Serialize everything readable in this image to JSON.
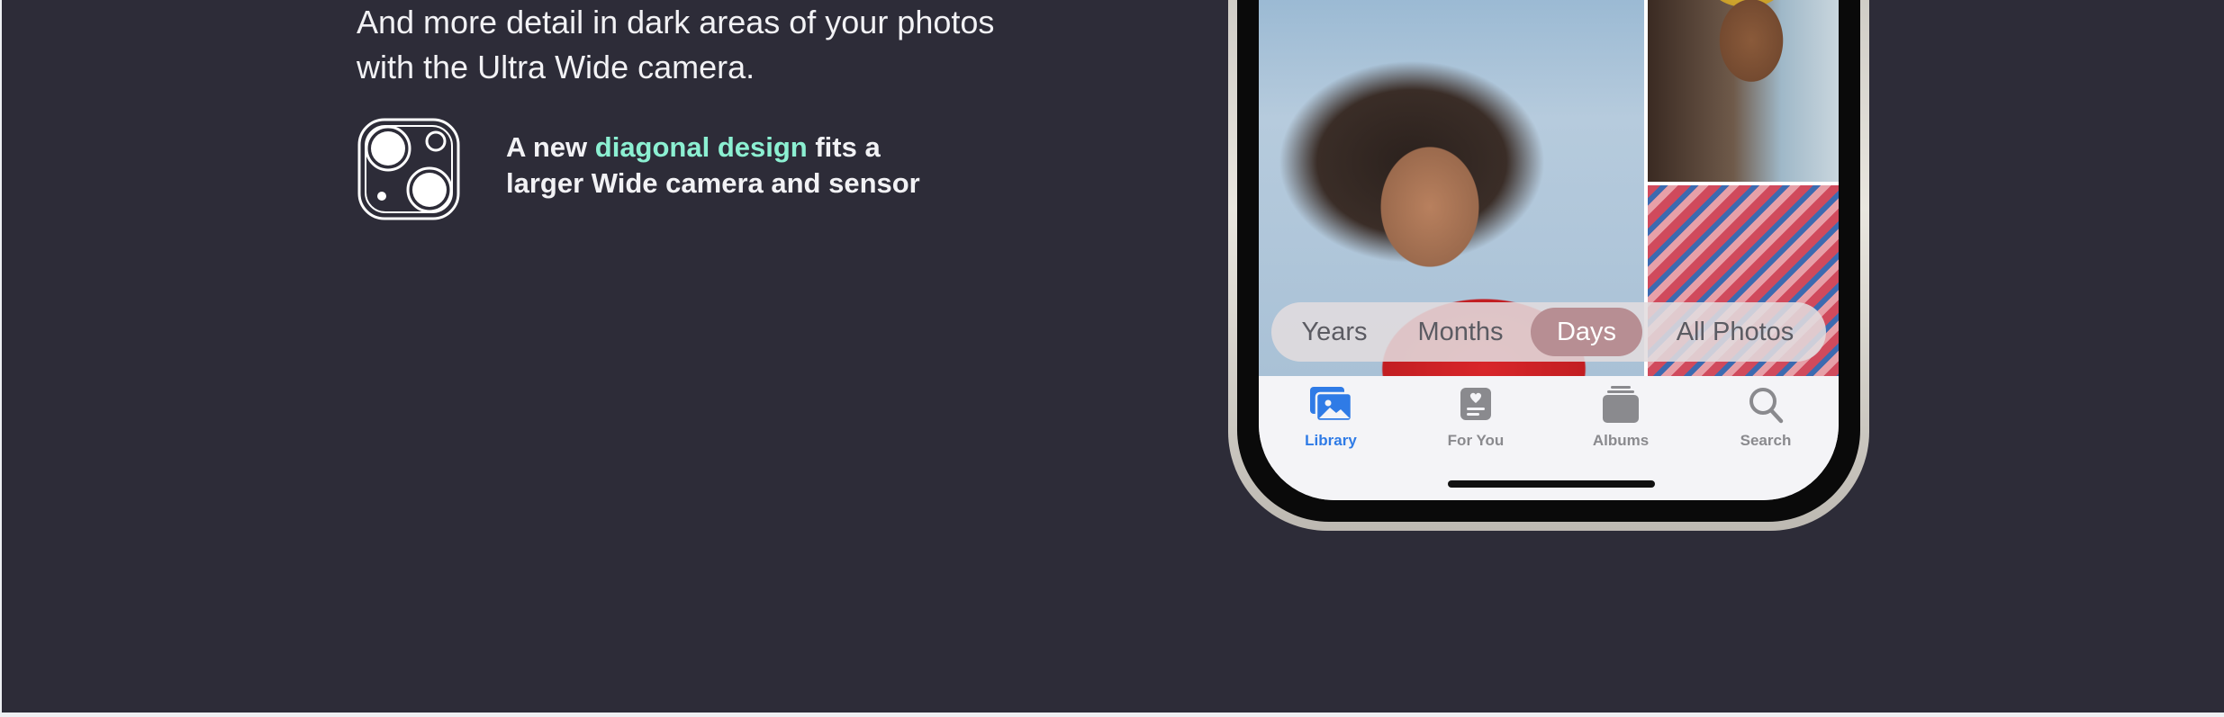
{
  "intro": {
    "line1": "And more detail in dark areas of your photos",
    "line2": "with the Ultra Wide camera."
  },
  "feature": {
    "icon": "dual-camera-icon",
    "text_before": "A new ",
    "highlight": "diagonal design",
    "text_after": " fits a",
    "line2": "larger Wide camera and sensor",
    "highlight_color": "#8cf0d2"
  },
  "phone": {
    "segments": [
      {
        "label": "Years"
      },
      {
        "label": "Months"
      },
      {
        "label": "Days",
        "selected": true
      },
      {
        "label": "All Photos"
      }
    ],
    "tabs": [
      {
        "label": "Library",
        "icon": "photo-library-icon",
        "active": true
      },
      {
        "label": "For You",
        "icon": "for-you-icon"
      },
      {
        "label": "Albums",
        "icon": "albums-icon"
      },
      {
        "label": "Search",
        "icon": "search-icon"
      }
    ],
    "accent_color": "#2f7be6"
  },
  "colors": {
    "background": "#2d2c38",
    "text": "#f2f2f5"
  }
}
